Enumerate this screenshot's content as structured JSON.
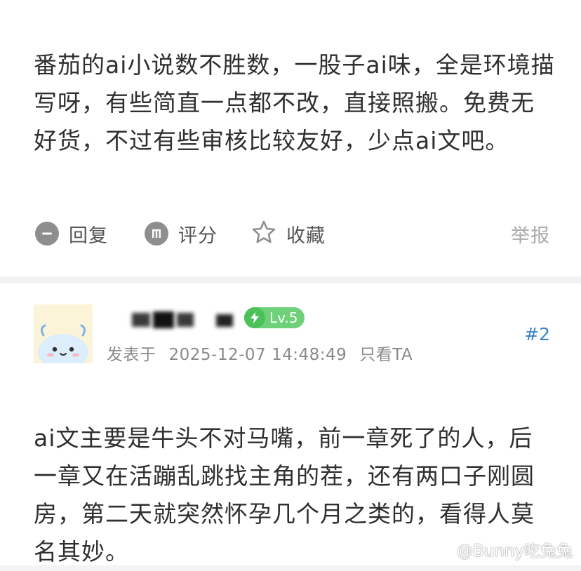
{
  "posts": [
    {
      "lines": [
        "番茄的ai小说数不胜数，一股子ai味，全是环境描",
        "写呀，有些简直一点都不改，直接照搬。免费无",
        "好货，不过有些审核比较友好，少点ai文吧。"
      ],
      "actions": {
        "reply": "回复",
        "rate": "评分",
        "favorite": "收藏",
        "report": "举报"
      }
    },
    {
      "level": "Lv.5",
      "posted_prefix": "发表于",
      "posted_time": "2025-12-07 14:48:49",
      "only_view": "只看TA",
      "floor": "#2",
      "lines": [
        "ai文主要是牛头不对马嘴，前一章死了的人，后",
        "一章又在活蹦乱跳找主角的茬，还有两口子刚圆",
        "房，第二天就突然怀孕几个月之类的，看得人莫",
        "名其妙。"
      ]
    }
  ],
  "watermark": "@Bunny吃兔兔",
  "icons": {
    "reply": "speech-bubble-icon",
    "rate": "coin-icon",
    "favorite": "star-outline-icon",
    "level": "lightning-bolt-icon",
    "watermark": "weibo-logo-icon"
  },
  "colors": {
    "floor_link": "#3a82c8",
    "level_badge": "#6fd07a",
    "muted": "#aaaaaa"
  }
}
